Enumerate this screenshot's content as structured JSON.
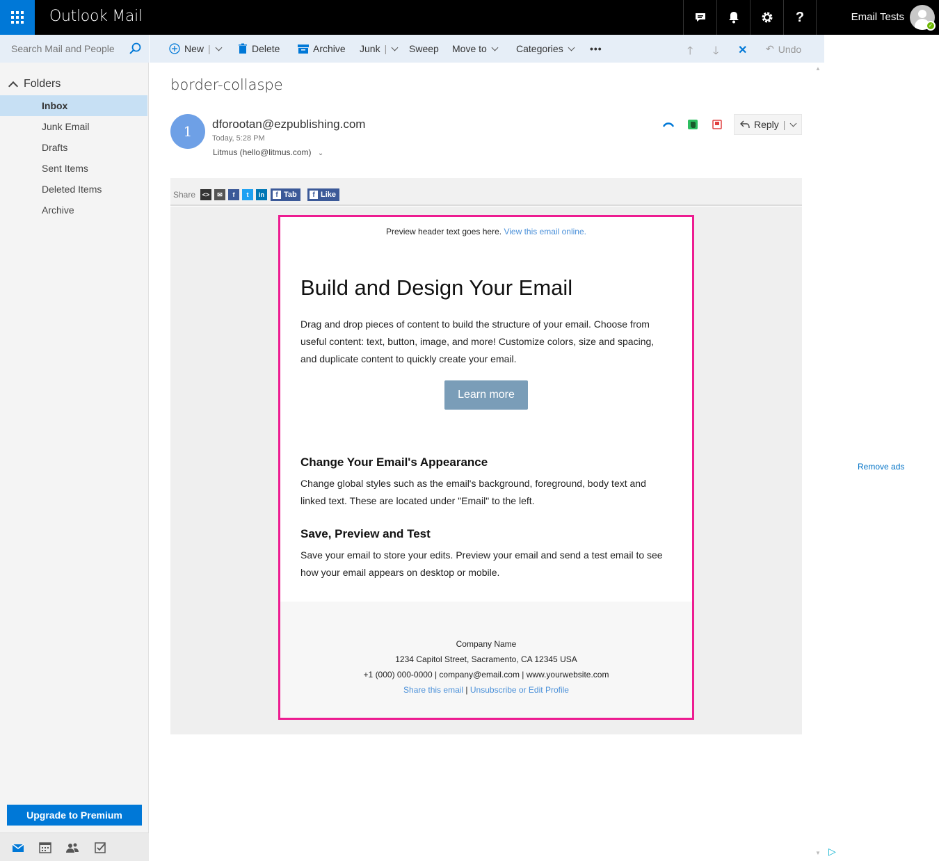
{
  "app": {
    "title": "Outlook Mail",
    "user": "Email Tests"
  },
  "search": {
    "placeholder": "Search Mail and People"
  },
  "nav": {
    "folders_label": "Folders",
    "folders": [
      {
        "label": "Inbox",
        "active": true
      },
      {
        "label": "Junk Email"
      },
      {
        "label": "Drafts"
      },
      {
        "label": "Sent Items"
      },
      {
        "label": "Deleted Items"
      },
      {
        "label": "Archive"
      }
    ],
    "upgrade_label": "Upgrade to Premium"
  },
  "toolbar": {
    "new": "New",
    "delete": "Delete",
    "archive": "Archive",
    "junk": "Junk",
    "sweep": "Sweep",
    "move_to": "Move to",
    "categories": "Categories",
    "more": "•••",
    "undo": "Undo"
  },
  "message": {
    "subject": "border-collaspe",
    "avatar_initial": "1",
    "from": "dforootan@ezpublishing.com",
    "time": "Today, 5:28 PM",
    "to": "Litmus (hello@litmus.com)",
    "reply_label": "Reply"
  },
  "share": {
    "label": "Share",
    "tab_label": "Tab",
    "like_label": "Like"
  },
  "email": {
    "preheader": "Preview header text goes here.",
    "preheader_link": "View this email online.",
    "heading": "Build and Design Your Email",
    "intro": "Drag and drop pieces of content to build the structure of your email. Choose from useful content: text, button, image, and more! Customize colors, size and spacing, and duplicate content to quickly create your email.",
    "button": "Learn more",
    "section1_title": "Change Your Email's Appearance",
    "section1_body": "Change global styles such as the email's background, foreground, body text and linked text. These are located under \"Email\" to the left.",
    "section2_title": "Save, Preview and Test",
    "section2_body": "Save your email to store your edits. Preview your email and send a test email to see how your email appears on desktop or mobile.",
    "footer": {
      "company": "Company Name",
      "address": "1234 Capitol Street, Sacramento, CA 12345 USA",
      "contact": "+1 (000) 000-0000 | company@email.com | www.yourwebsite.com",
      "share_link": "Share this email",
      "separator": "|",
      "unsubscribe_link": "Unsubscribe or Edit Profile"
    }
  },
  "ads": {
    "remove_label": "Remove ads"
  },
  "colors": {
    "brand": "#0078d7",
    "email_border": "#ed1c91",
    "button": "#7a9db8"
  }
}
